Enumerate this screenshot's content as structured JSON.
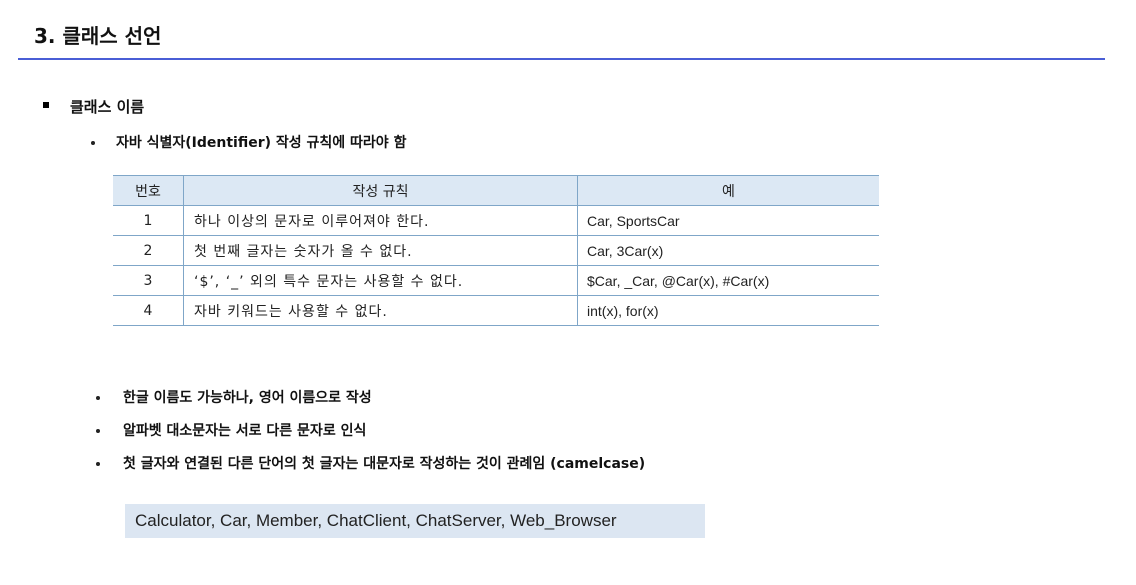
{
  "title": "3. 클래스 선언",
  "section": {
    "heading": "클래스 이름",
    "rule_intro": "자바 식별자(Identifier) 작성 규칙에 따라야 함"
  },
  "table": {
    "headers": [
      "번호",
      "작성 규칙",
      "예"
    ],
    "rows": [
      {
        "no": "1",
        "rule": "하나 이상의 문자로 이루어져야 한다.",
        "example": "Car, SportsCar"
      },
      {
        "no": "2",
        "rule": "첫 번째 글자는 숫자가 올 수 없다.",
        "example": "Car, 3Car(x)"
      },
      {
        "no": "3",
        "rule": "‘$’, ‘_’ 외의 특수 문자는 사용할 수 없다.",
        "example": "$Car, _Car, @Car(x), #Car(x)"
      },
      {
        "no": "4",
        "rule": "자바 키워드는 사용할 수 없다.",
        "example": "int(x), for(x)"
      }
    ]
  },
  "bullets": [
    "한글 이름도 가능하나, 영어 이름으로 작성",
    "알파벳 대소문자는 서로 다른 문자로 인식",
    "첫 글자와 연결된 다른 단어의 첫 글자는 대문자로 작성하는 것이 관례임 (camelcase)"
  ],
  "example_names": "Calculator, Car, Member, ChatClient, ChatServer, Web_Browser"
}
